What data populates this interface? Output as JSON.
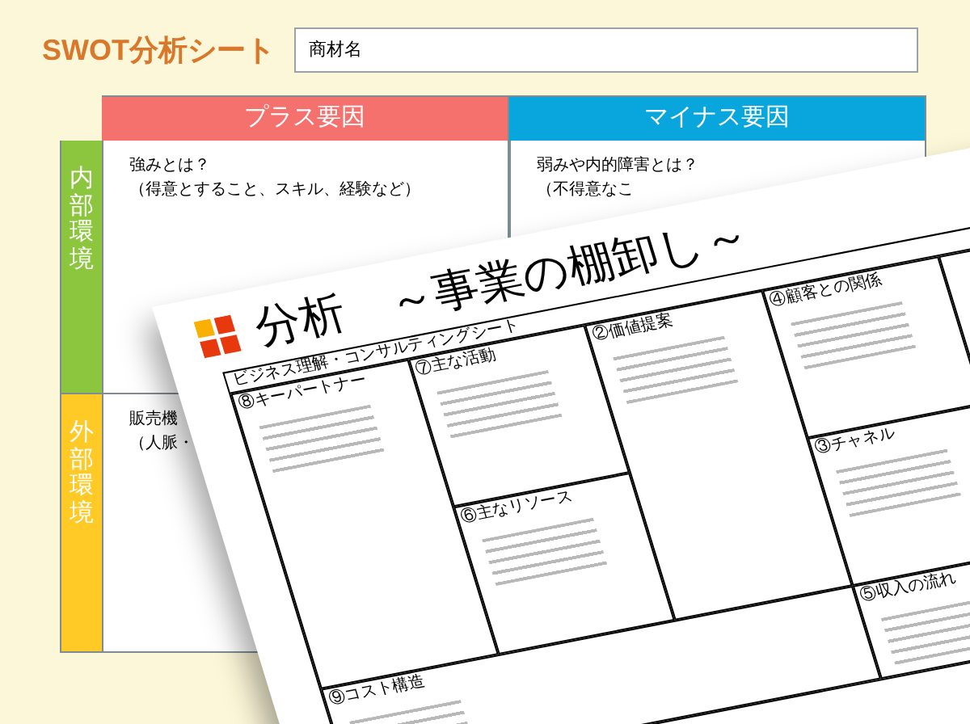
{
  "title": "SWOT分析シート",
  "product_field": {
    "placeholder": "商材名"
  },
  "columns": [
    {
      "label": "プラス要因",
      "color": "#f5716e"
    },
    {
      "label": "マイナス要因",
      "color": "#08a6dc"
    }
  ],
  "rows": [
    {
      "label": "内部環境",
      "color": "#8cc63f",
      "cells": [
        [
          "強みとは？",
          "（得意とすること、スキル、経験など）"
        ],
        [
          "弱みや内的障害とは？",
          "（不得意なこ"
        ]
      ]
    },
    {
      "label": "外部環境",
      "color": "#ffc926",
      "cells": [
        [
          "販売機",
          "（人脈・"
        ],
        []
      ]
    }
  ],
  "document": {
    "title": "分析　～事業の棚卸し～",
    "subtitle": "ビジネス理解・コンサルティングシート",
    "blocks": [
      {
        "header": "⑧キーパートナー"
      },
      {
        "header": "⑦主な活動"
      },
      {
        "header": "⑥主なリソース"
      },
      {
        "header": "②価値提案"
      },
      {
        "header": "④顧客との関係"
      },
      {
        "header": "③チャネル"
      },
      {
        "header": "⑨コスト構造"
      },
      {
        "header": "⑤収入の流れ"
      }
    ]
  }
}
